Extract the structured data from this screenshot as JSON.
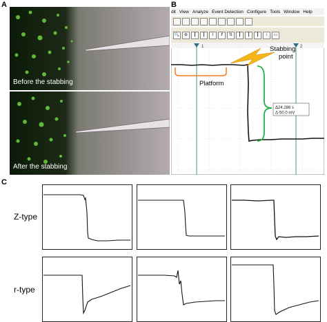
{
  "panels": {
    "a": "A",
    "b": "B",
    "c": "C"
  },
  "micrographs": {
    "before_caption": "Before the stabbing",
    "after_caption": "After the stabbing"
  },
  "software": {
    "menu": [
      "dit",
      "View",
      "Analyze",
      "Event Detection",
      "Configure",
      "Tools",
      "Window",
      "Help"
    ],
    "toolbar_row1_icons": [
      "open-icon",
      "save-icon",
      "copy-icon",
      "paste-icon",
      "print-icon",
      "table-icon",
      "zoom-window-icon",
      "tile-icon",
      "tile-h-icon"
    ],
    "toolbar_row2_icons": [
      "zoom-icon",
      "measure-icon",
      "cursor-icon",
      "cursor2-icon",
      "fit-icon",
      "fx-icon",
      "sort-icon",
      "cursor3-icon",
      "cursor4-icon",
      "cursor5-icon",
      "scroll-icon",
      "split-icon"
    ],
    "cursor_markers": [
      "1",
      "2"
    ],
    "annotations": {
      "platform": "Platform",
      "stabbing_line1": "Stabbing",
      "stabbing_line2": "point",
      "delta_time": "Δ24.286 s",
      "delta_voltage": "Δ-50.0 mV"
    },
    "colors": {
      "platform_bracket": "#f07a1c",
      "delta_bracket": "#1db44a",
      "cursor_line": "#3a9a9a",
      "lightning": "#f5b417"
    }
  },
  "traces": {
    "z_type_label": "Z-type",
    "r_type_label": "r-type"
  }
}
